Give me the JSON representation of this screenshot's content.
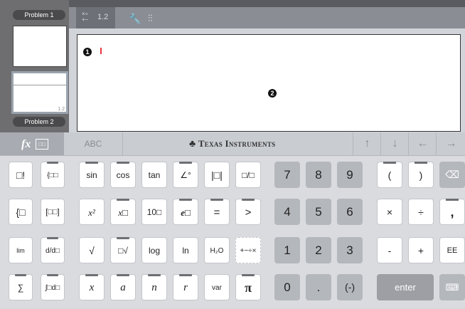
{
  "sidebar": {
    "problem1_label": "Problem 1",
    "problem2_label": "Problem 2",
    "page_number": "1.2"
  },
  "toolbar": {
    "tab_label": "1.2"
  },
  "canvas": {
    "badge1": "1",
    "badge2": "2"
  },
  "keyboard_header": {
    "fx_label": "fx",
    "abc_label": "ABC",
    "brand": "Texas Instruments",
    "arrows": [
      "↑",
      "↓",
      "←",
      "→"
    ]
  },
  "keys": {
    "template_col1": [
      "□!",
      "{□",
      "lim",
      "∑"
    ],
    "template_col2": [
      "{□□",
      "[□□]",
      "d/d□",
      "∫□d□"
    ],
    "row1": [
      "sin",
      "cos",
      "tan",
      "∠°",
      "|□|",
      "□/□"
    ],
    "row2": [
      "x²",
      "x□",
      "10□",
      "e□",
      "=",
      ">"
    ],
    "row3": [
      "√",
      "□√",
      "log",
      "ln",
      "H₂O",
      "+−÷×"
    ],
    "row4": [
      "x",
      "a",
      "n",
      "r",
      "var",
      "π"
    ],
    "digits": [
      "7",
      "8",
      "9",
      "4",
      "5",
      "6",
      "1",
      "2",
      "3",
      "0",
      ".",
      "(-)"
    ],
    "ops": [
      "(",
      ")",
      "×",
      "÷",
      ",",
      "-",
      "+",
      "EE"
    ],
    "enter": "enter"
  }
}
